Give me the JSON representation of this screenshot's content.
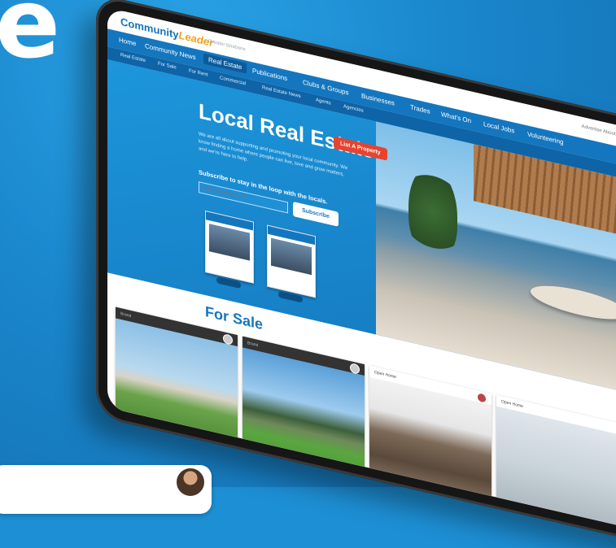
{
  "page": {
    "headline": "e"
  },
  "site": {
    "logo_main": "Community",
    "logo_accent": "Leader",
    "logo_sub": "Greater Brisbane"
  },
  "nav": {
    "items": [
      "Home",
      "Community News",
      "Real Estate",
      "Publications",
      "Clubs & Groups",
      "Businesses",
      "Trades",
      "What's On",
      "Local Jobs",
      "Volunteering"
    ]
  },
  "subnav": {
    "items": [
      "Real Estate",
      "For Sale",
      "For Rent",
      "Commercial",
      "Real Estate News",
      "Agents",
      "Agencies"
    ]
  },
  "header_links": "Advertise  About  Contact Us",
  "hero": {
    "title": "Local Real Estate",
    "text": "We are all about supporting and promoting your local community. We know finding a home where people can live, love and grow matters, and we're here to help.",
    "cta": "Subscribe to stay in the loop with the locals.",
    "email_placeholder": "email@address.com",
    "subscribe_label": "Subscribe",
    "list_property_label": "List A Property"
  },
  "section": {
    "for_sale_title": "For Sale"
  },
  "listings": [
    {
      "status": "Brand"
    },
    {
      "status": "Brand"
    },
    {
      "status": "Open Home"
    },
    {
      "status": "Open Home"
    }
  ],
  "colors": {
    "brand_blue": "#1476bf",
    "accent_red": "#e8432e",
    "background": "#1d8fd4"
  }
}
